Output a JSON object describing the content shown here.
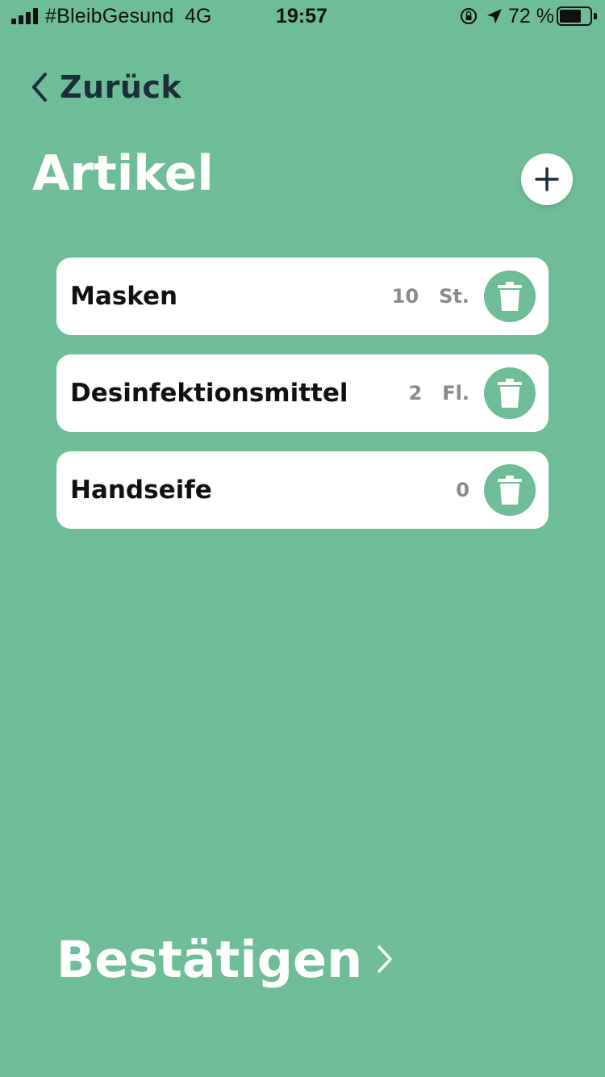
{
  "status_bar": {
    "carrier": "#BleibGesund",
    "network": "4G",
    "time": "19:57",
    "battery_percent_label": "72 %",
    "battery_level": 0.72,
    "icons": [
      "signal-icon",
      "orientation-lock-icon",
      "location-arrow-icon",
      "battery-icon"
    ]
  },
  "nav": {
    "back_label": "Zurück",
    "back_icon": "chevron-left-icon"
  },
  "header": {
    "title": "Artikel",
    "add_icon": "plus-icon"
  },
  "items": [
    {
      "name": "Masken",
      "quantity": "10",
      "unit": "St."
    },
    {
      "name": "Desinfektionsmittel",
      "quantity": "2",
      "unit": "Fl."
    },
    {
      "name": "Handseife",
      "quantity": "0",
      "unit": ""
    }
  ],
  "footer": {
    "confirm_label": "Bestätigen",
    "confirm_icon": "chevron-right-icon"
  },
  "colors": {
    "background": "#6fbd98",
    "card": "#ffffff",
    "text_dark": "#1c2e3a",
    "quantity_gray": "#8a8a8a"
  }
}
